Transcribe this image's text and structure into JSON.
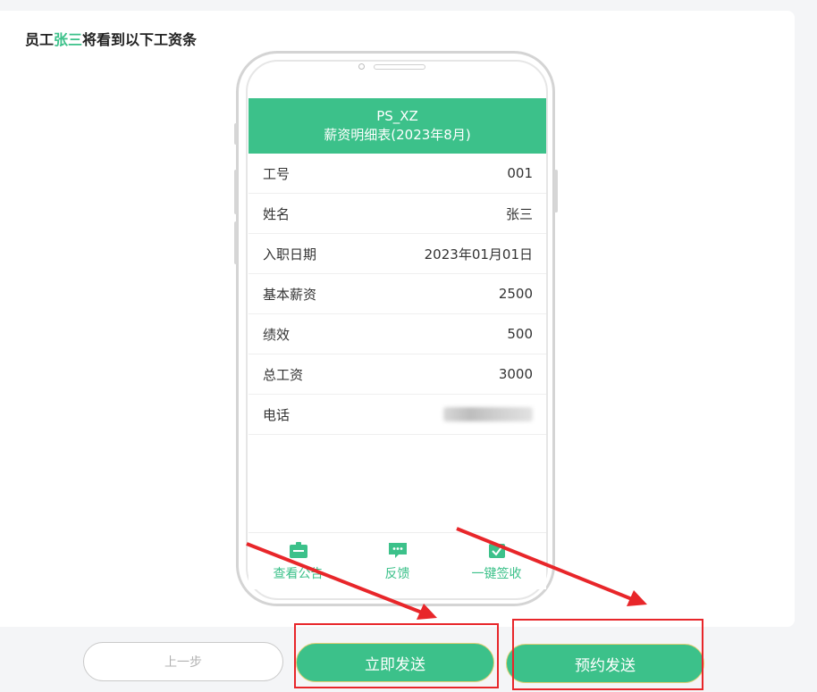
{
  "heading": {
    "prefix": "员工",
    "name": "张三",
    "suffix": "将看到以下工资条"
  },
  "payslip": {
    "company": "PS_XZ",
    "subtitle": "薪资明细表(2023年8月)",
    "rows": [
      {
        "label": "工号",
        "value": "001"
      },
      {
        "label": "姓名",
        "value": "张三"
      },
      {
        "label": "入职日期",
        "value": "2023年01月01日"
      },
      {
        "label": "基本薪资",
        "value": "2500"
      },
      {
        "label": "绩效",
        "value": "500"
      },
      {
        "label": "总工资",
        "value": "3000"
      },
      {
        "label": "电话",
        "value": ""
      }
    ]
  },
  "tabs": [
    {
      "label": "查看公告",
      "icon": "announcement-icon"
    },
    {
      "label": "反馈",
      "icon": "feedback-chat-icon"
    },
    {
      "label": "一键签收",
      "icon": "sign-receipt-icon"
    }
  ],
  "buttons": {
    "prev": "上一步",
    "send_now": "立即发送",
    "schedule": "预约发送"
  },
  "colors": {
    "accent": "#3cc18a",
    "annotation_red": "#e8262a"
  }
}
